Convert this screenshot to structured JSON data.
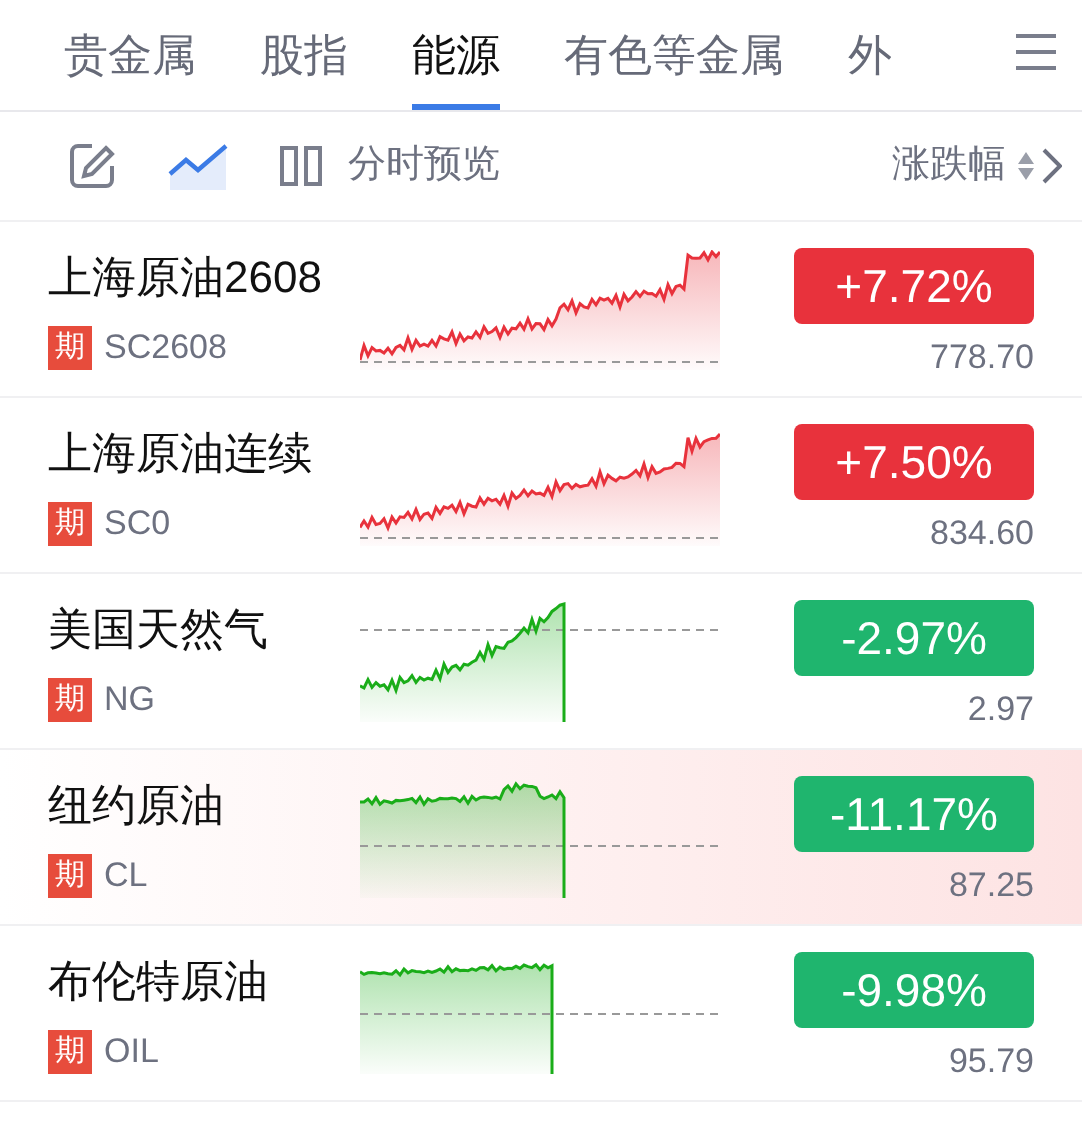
{
  "tabs": [
    {
      "label": "贵金属",
      "selected": false
    },
    {
      "label": "股指",
      "selected": false
    },
    {
      "label": "能源",
      "selected": true
    },
    {
      "label": "有色等金属",
      "selected": false
    },
    {
      "label": "外",
      "selected": false
    }
  ],
  "toolbar": {
    "chart_view_selected": true,
    "preview_label": "分时预览",
    "sort_label": "涨跌幅"
  },
  "rows": [
    {
      "name": "上海原油2608",
      "tag": "期",
      "code": "SC2608",
      "change": "+7.72%",
      "price": "778.70",
      "rising": true,
      "highlighted": false
    },
    {
      "name": "上海原油连续",
      "tag": "期",
      "code": "SC0",
      "change": "+7.50%",
      "price": "834.60",
      "rising": true,
      "highlighted": false
    },
    {
      "name": "美国天然气",
      "tag": "期",
      "code": "NG",
      "change": "-2.97%",
      "price": "2.97",
      "rising": false,
      "highlighted": false
    },
    {
      "name": "纽约原油",
      "tag": "期",
      "code": "CL",
      "change": "-11.17%",
      "price": "87.25",
      "rising": false,
      "highlighted": true
    },
    {
      "name": "布伦特原油",
      "tag": "期",
      "code": "OIL",
      "change": "-9.98%",
      "price": "95.79",
      "rising": false,
      "highlighted": false
    }
  ]
}
